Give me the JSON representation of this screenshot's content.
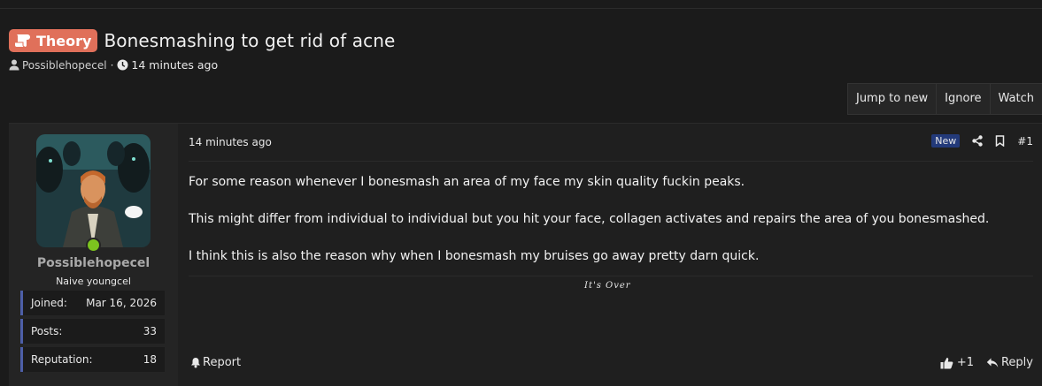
{
  "thread": {
    "prefix": "Theory",
    "title": "Bonesmashing to get rid of acne",
    "author": "Possiblehopecel",
    "separator": "·",
    "time": "14 minutes ago"
  },
  "buttons": {
    "jump": "Jump to new",
    "ignore": "Ignore",
    "watch": "Watch"
  },
  "user": {
    "name": "Possiblehopecel",
    "title": "Naive youngcel",
    "stats": [
      {
        "label": "Joined:",
        "value": "Mar 16, 2026"
      },
      {
        "label": "Posts:",
        "value": "33"
      },
      {
        "label": "Reputation:",
        "value": "18"
      }
    ]
  },
  "post": {
    "date": "14 minutes ago",
    "badge": "New",
    "number": "#1",
    "paragraphs": [
      "For some reason whenever I bonesmash an area of my face my skin quality fuckin peaks.",
      "This might differ from individual to individual but you hit your face, collagen activates and repairs the area of you bonesmashed.",
      "I think this is also the reason why when I bonesmash my bruises go away pretty darn quick."
    ],
    "signature": "It's Over"
  },
  "footer": {
    "report": "Report",
    "likes": "+1",
    "reply": "Reply"
  },
  "colors": {
    "prefix": "#e0705a",
    "online": "#7cc41f",
    "stat_border": "#4d5fa8",
    "new_badge": "#233a7a"
  }
}
